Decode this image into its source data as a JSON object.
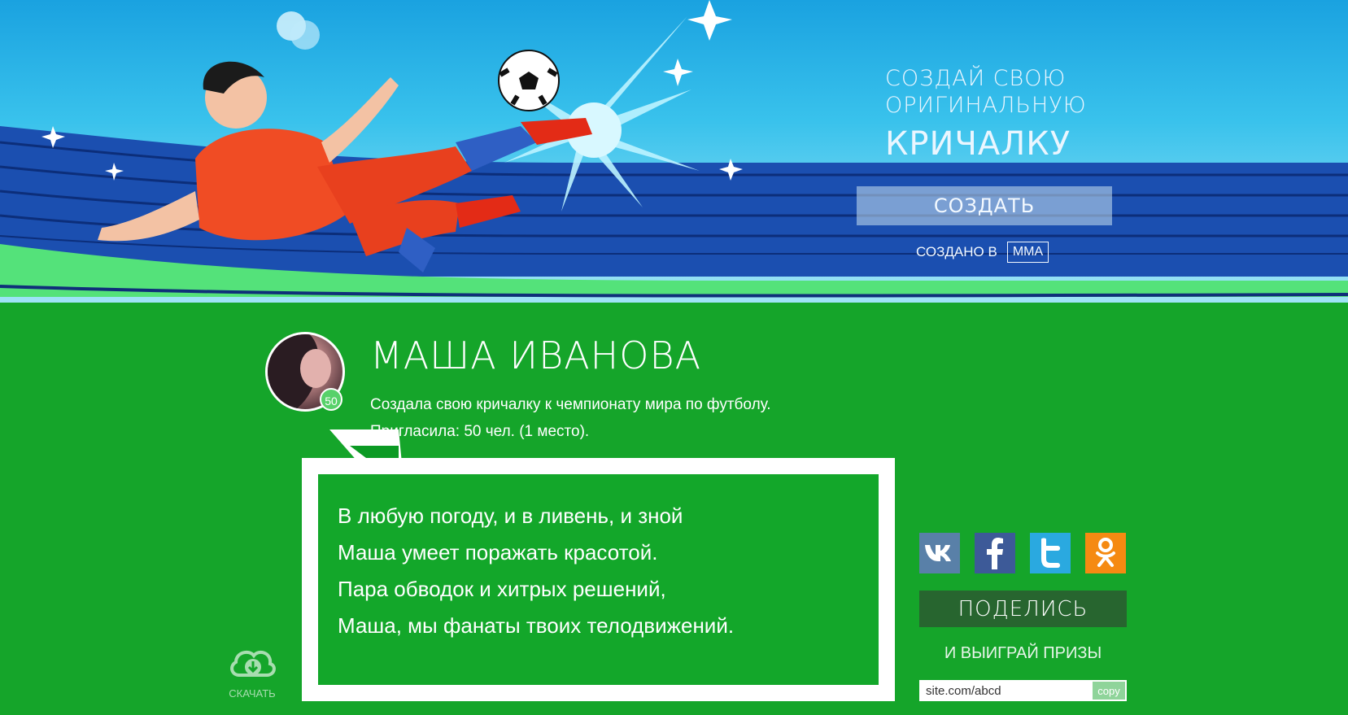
{
  "hero": {
    "cta_line1": "Создай свою",
    "cta_line2": "оригинальную",
    "cta_big": "кричалку",
    "create_button": "Создать",
    "made_in_label": "Создано в",
    "made_in_badge": "MMA"
  },
  "profile": {
    "name": "Маша Иванова",
    "avatar_count": "50",
    "info_line1": "Создала свою кричалку к чемпионату мира по футболу.",
    "info_line2": "Пригласила: 50 чел. (1 место)."
  },
  "poem": {
    "lines": [
      "В любую погоду, и в ливень, и зной",
      "Маша умеет поражать красотой.",
      "Пара обводок и хитрых решений,",
      "Маша, мы фанаты твоих телодвижений."
    ]
  },
  "download": {
    "label": "Скачать",
    "icon": "cloud-download-icon"
  },
  "share": {
    "networks": [
      {
        "name": "vk",
        "icon": "vk-icon",
        "color": "#5980a8"
      },
      {
        "name": "facebook",
        "icon": "facebook-icon",
        "color": "#3d5a98"
      },
      {
        "name": "twitter",
        "icon": "twitter-icon",
        "color": "#2aa9e0"
      },
      {
        "name": "odnoklassniki",
        "icon": "odnoklassniki-icon",
        "color": "#f58a12"
      }
    ],
    "button": "Поделись",
    "subtitle": "и выиграй призы",
    "link_value": "site.com/abcd",
    "copy_label": "copy"
  },
  "colors": {
    "page_green": "#15a52a",
    "share_button": "#27652f",
    "sky": "#1aa2e0"
  }
}
